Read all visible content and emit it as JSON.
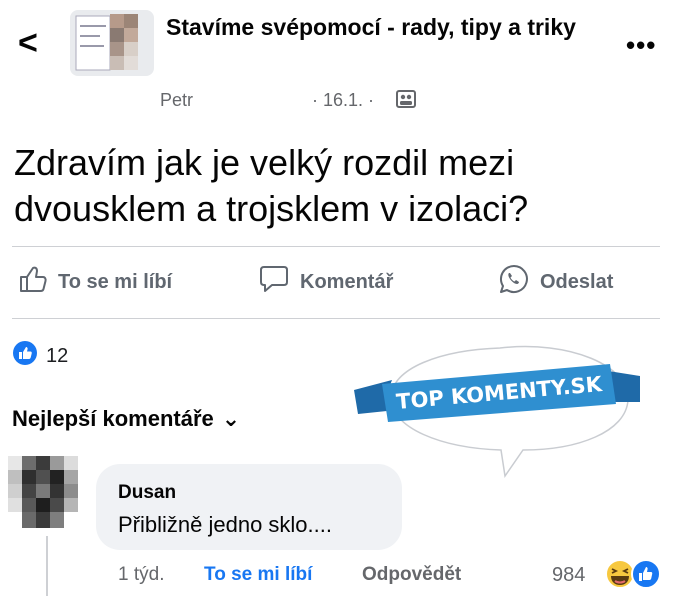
{
  "header": {
    "back_glyph": "<",
    "group_title": "Stavíme svépomocí - rady, tipy a triky",
    "author": "Petr",
    "date": "· 16.1. ·",
    "more_glyph": "•••"
  },
  "post": {
    "text": "Zdravím jak je velký rozdil mezi dvousklem a trojsklem v izolaci?"
  },
  "actions": {
    "like": "To se mi líbí",
    "comment": "Komentář",
    "share": "Odeslat"
  },
  "reactions": {
    "count": "12"
  },
  "stamp": {
    "text": "TOP KOMENTY.SK"
  },
  "comments_sort": {
    "label": "Nejlepší komentáře",
    "chevron": "⌄"
  },
  "comment": {
    "author": "Dusan",
    "text": "Přibližně jedno sklo....",
    "time": "1 týd.",
    "like_label": "To se mi líbí",
    "reply_label": "Odpovědět",
    "reaction_count": "984"
  },
  "colors": {
    "accent": "#1877f2",
    "secondary_text": "#65676b",
    "stamp_blue": "#2f8fd0"
  }
}
